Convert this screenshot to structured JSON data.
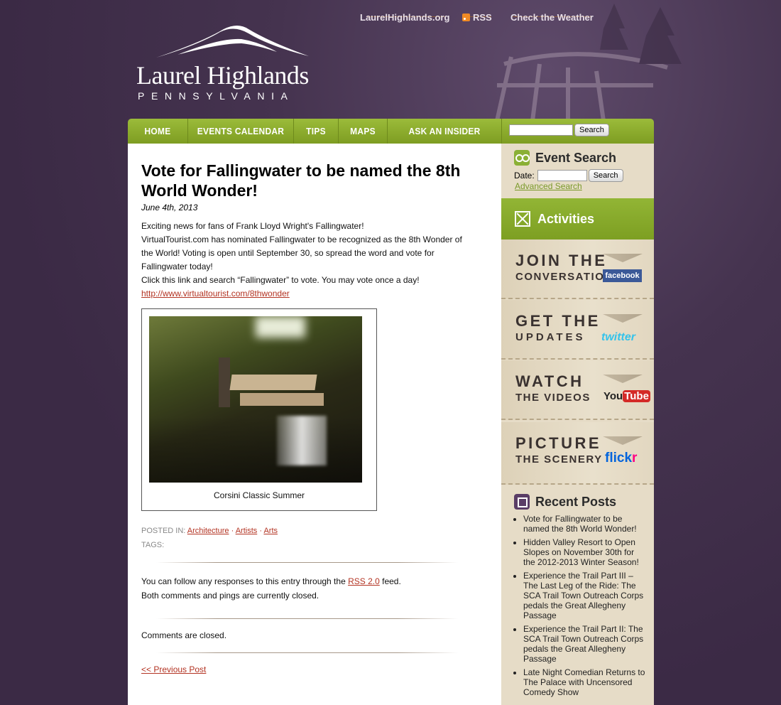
{
  "header": {
    "top_links": [
      "LaurelHighlands.org",
      "RSS",
      "Check the Weather"
    ],
    "logo_title": "Laurel Highlands",
    "logo_subtitle": "PENNSYLVANIA"
  },
  "nav": {
    "items": [
      "HOME",
      "EVENTS CALENDAR",
      "TIPS",
      "MAPS",
      "ASK AN INSIDER"
    ],
    "search_button": "Search",
    "search_value": ""
  },
  "post": {
    "title": "Vote for Fallingwater to be named the 8th World Wonder!",
    "date": "June 4th, 2013",
    "paragraph1": "Exciting news for fans of Frank Lloyd Wright's Fallingwater!",
    "paragraph2": "VirtualTourist.com has nominated Fallingwater to be recognized as the 8th Wonder of the World! Voting is open until September 30, so spread the word and vote for Fallingwater today!",
    "paragraph3": "Click this link and search “Fallingwater” to vote. You may vote once a day!",
    "link": "http://www.virtualtourist.com/8thwonder",
    "image_caption": "Corsini Classic Summer",
    "posted_in_label": "POSTED IN:",
    "categories": [
      "Architecture",
      "Artists",
      "Arts"
    ],
    "tags_label": "TAGS:",
    "follow_text_before": "You can follow any responses to this entry through the ",
    "rss_link": "RSS 2.0",
    "follow_text_after": " feed.",
    "closed_pings": "Both comments and pings are currently closed.",
    "comments_closed": "Comments are closed.",
    "previous_post": "<< Previous Post"
  },
  "sidebar": {
    "event_search_title": "Event Search",
    "date_label": "Date:",
    "date_value": "",
    "search_button": "Search",
    "advanced_search": "Advanced Search",
    "activities": "Activities",
    "social": [
      {
        "line1": "JOIN THE",
        "line2": "CONVERSATION",
        "brand": "facebook"
      },
      {
        "line1": "GET THE",
        "line2": "UPDATES",
        "brand": "twitter"
      },
      {
        "line1": "WATCH",
        "line2": "THE VIDEOS",
        "brand": "YouTube"
      },
      {
        "line1": "PICTURE",
        "line2": "THE SCENERY",
        "brand": "flickr"
      }
    ],
    "recent_posts_title": "Recent Posts",
    "recent_posts": [
      "Vote for Fallingwater to be named the 8th World Wonder!",
      "Hidden Valley Resort to Open Slopes on November 30th for the 2012-2013 Winter Season!",
      "Experience the Trail Part III – The Last Leg of the Ride: The SCA Trail Town Outreach Corps pedals the Great Allegheny Passage",
      "Experience the Trail Part II: The SCA Trail Town Outreach Corps pedals the Great Allegheny Passage",
      "Late Night Comedian Returns to The Palace with Uncensored Comedy Show"
    ]
  },
  "colors": {
    "background": "#3b2a45",
    "nav_green": "#8aad2e",
    "link_red": "#b33322",
    "sidebar_bg": "#e6dcc7"
  }
}
